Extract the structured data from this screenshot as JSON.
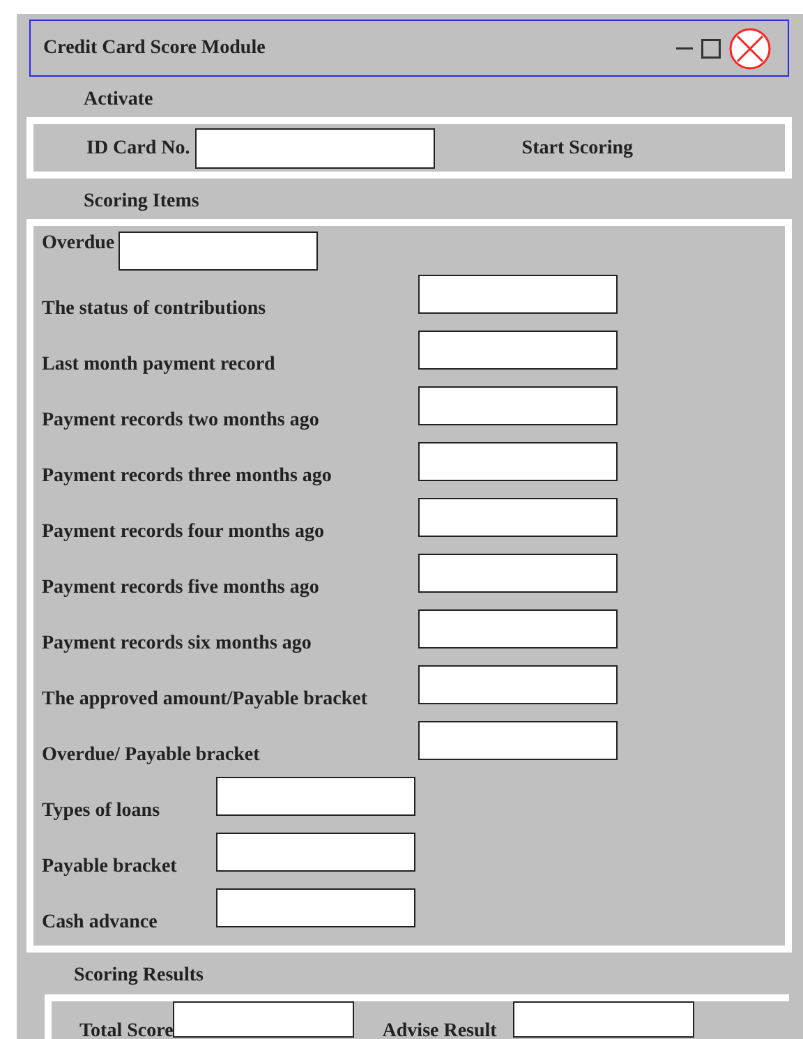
{
  "window": {
    "title": "Credit Card Score Module"
  },
  "activate": {
    "heading": "Activate",
    "id_label": "ID Card No.",
    "start_button": "Start Scoring"
  },
  "scoring_items": {
    "heading": "Scoring Items",
    "items": [
      {
        "label": "Overdue"
      },
      {
        "label": "The status of contributions"
      },
      {
        "label": "Last month payment record"
      },
      {
        "label": "Payment records two months ago"
      },
      {
        "label": "Payment records three months ago"
      },
      {
        "label": "Payment records four months ago"
      },
      {
        "label": "Payment records five months ago"
      },
      {
        "label": "Payment records six months ago"
      },
      {
        "label": "The approved amount/Payable bracket"
      },
      {
        "label": "Overdue/ Payable bracket"
      },
      {
        "label": "Types of loans"
      },
      {
        "label": "Payable bracket"
      },
      {
        "label": "Cash advance"
      }
    ]
  },
  "scoring_results": {
    "heading": "Scoring Results",
    "total_label": "Total Score",
    "advise_label": "Advise Result"
  }
}
